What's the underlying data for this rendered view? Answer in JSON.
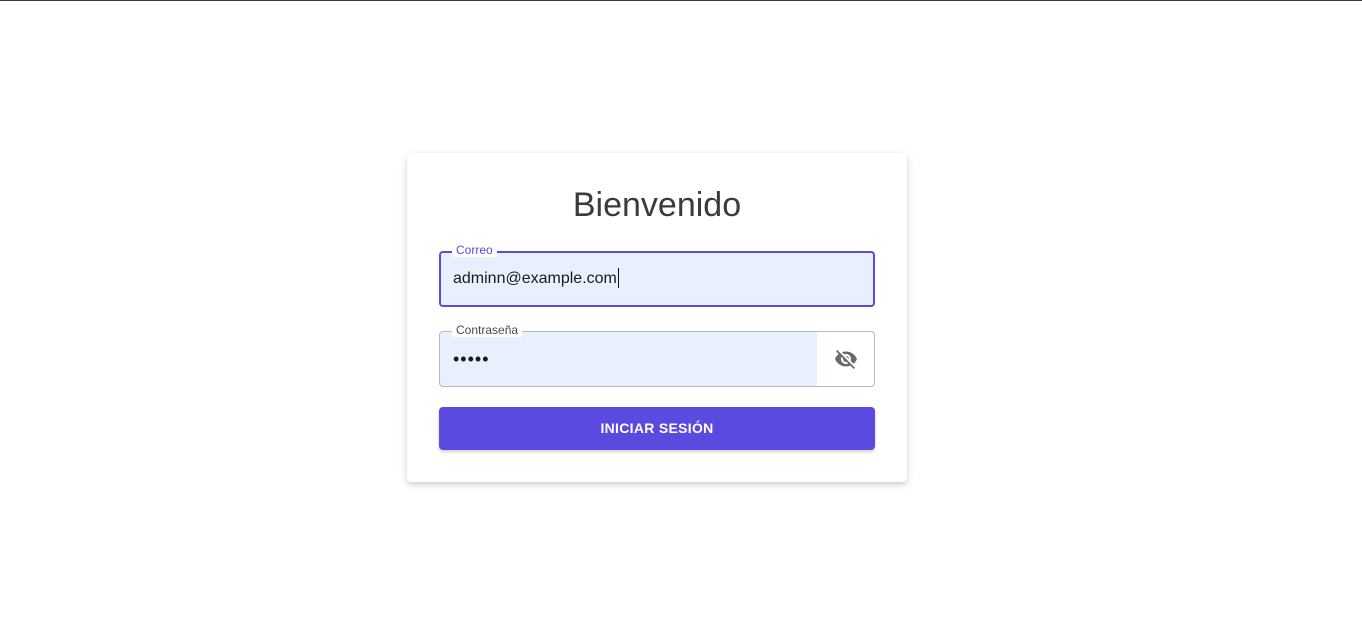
{
  "login": {
    "title": "Bienvenido",
    "email": {
      "label": "Correo",
      "value": "adminn@example.com"
    },
    "password": {
      "label": "Contraseña",
      "value": "•••••"
    },
    "visibility_icon": "eye-off-icon",
    "submit_label": "INICIAR SESIÓN"
  },
  "colors": {
    "accent": "#5b4ae0",
    "field_fill": "#e8effd",
    "focus_border": "#5b4bd6"
  }
}
